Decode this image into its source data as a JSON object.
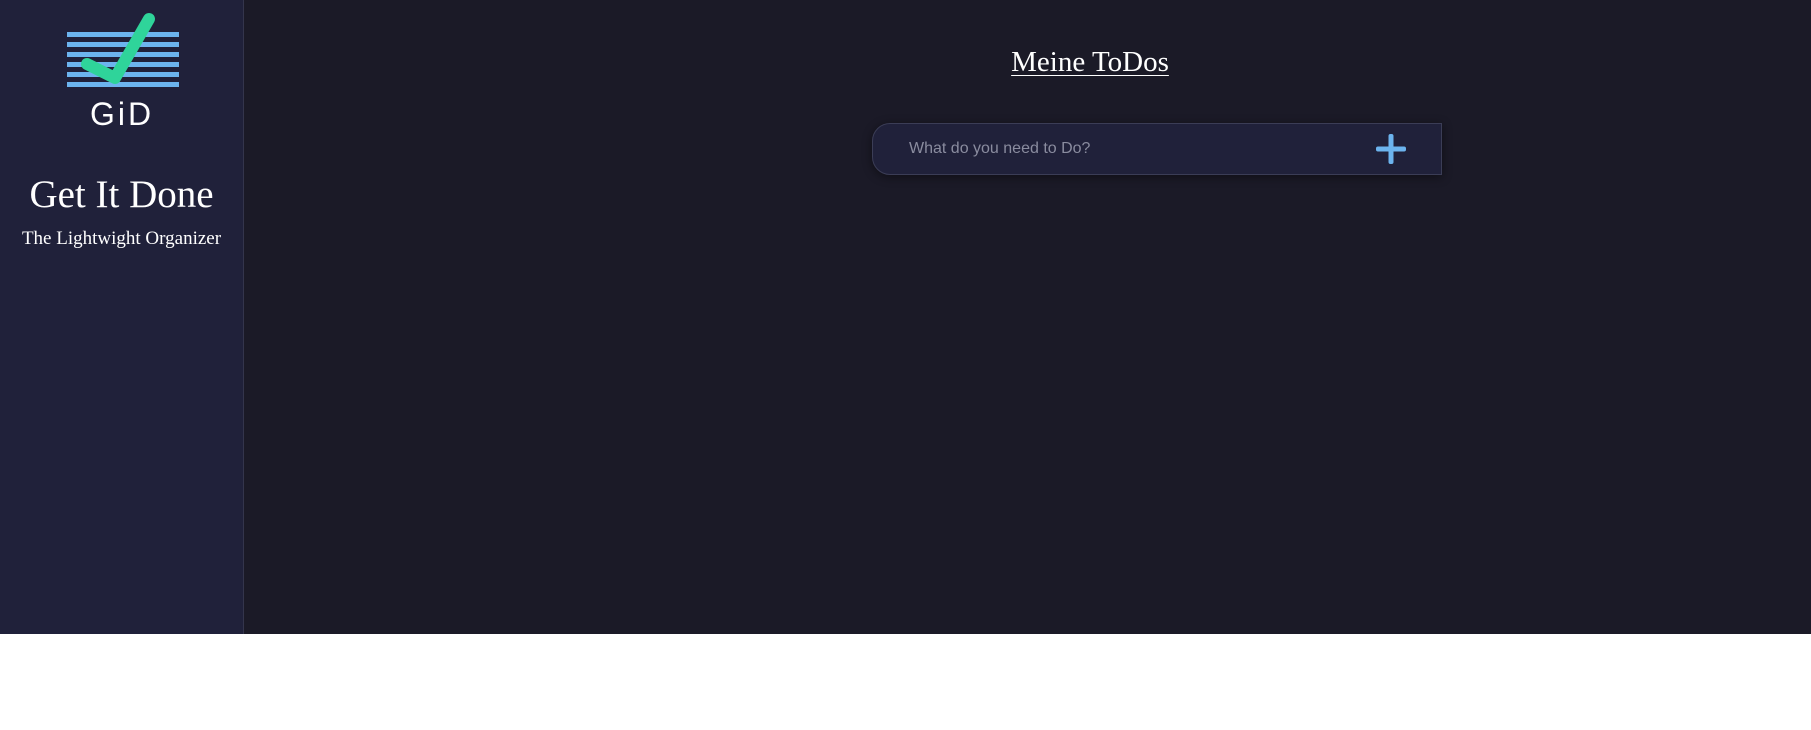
{
  "sidebar": {
    "logo": {
      "icon": "checkmark-lines-icon",
      "text": "GiD",
      "check_color": "#2fd49a",
      "lines_color": "#6cb4ee"
    },
    "title": "Get It Done",
    "subtitle": "The Lightwight Organizer"
  },
  "main": {
    "title": "Meine ToDos",
    "form": {
      "placeholder": "What do you need to Do?",
      "value": "",
      "add_icon": "plus-icon",
      "add_color": "#6cb4ee"
    }
  },
  "colors": {
    "background": "#1b1a27",
    "sidebar": "#20213a",
    "text": "#ffffff"
  }
}
